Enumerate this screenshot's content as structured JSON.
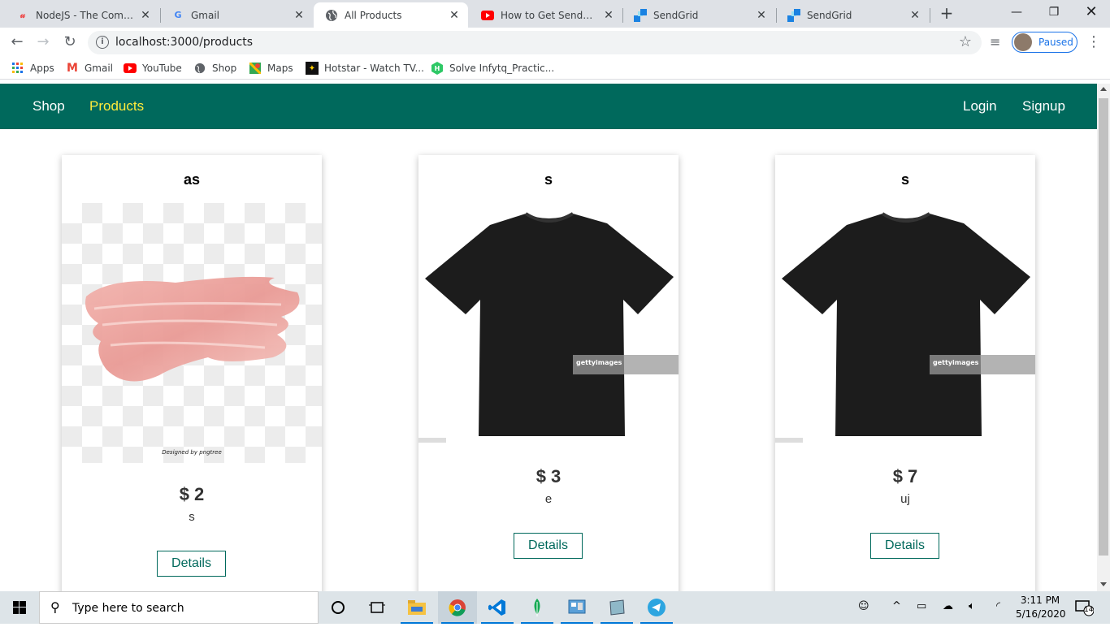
{
  "tabs": [
    {
      "title": "NodeJS - The Complete",
      "favicon": "U"
    },
    {
      "title": "Gmail",
      "favicon": "G"
    },
    {
      "title": "All Products",
      "favicon": "globe"
    },
    {
      "title": "How to Get SendGrid S",
      "favicon": "youtube"
    },
    {
      "title": "SendGrid",
      "favicon": "sendgrid"
    },
    {
      "title": "SendGrid",
      "favicon": "sendgrid"
    }
  ],
  "omnibox": {
    "url": "localhost:3000/products"
  },
  "profile": {
    "status": "Paused"
  },
  "bookmarks": [
    {
      "label": "Apps"
    },
    {
      "label": "Gmail"
    },
    {
      "label": "YouTube"
    },
    {
      "label": "Shop"
    },
    {
      "label": "Maps"
    },
    {
      "label": "Hotstar - Watch TV..."
    },
    {
      "label": "Solve Infytq_Practic..."
    }
  ],
  "nav": {
    "shop": "Shop",
    "products": "Products",
    "login": "Login",
    "signup": "Signup"
  },
  "products": [
    {
      "title": "as",
      "price": "$ 2",
      "description": "s",
      "button": "Details",
      "image_caption": "Designed by pngtree"
    },
    {
      "title": "s",
      "price": "$ 3",
      "description": "e",
      "button": "Details",
      "image_caption": "gettyimages"
    },
    {
      "title": "s",
      "price": "$ 7",
      "description": "uj",
      "button": "Details",
      "image_caption": "gettyimages"
    }
  ],
  "taskbar": {
    "search_placeholder": "Type here to search",
    "time": "3:11 PM",
    "date": "5/16/2020",
    "notifications": "14"
  },
  "colors": {
    "header_bg": "#00695c",
    "active_nav": "#ffeb3b"
  }
}
